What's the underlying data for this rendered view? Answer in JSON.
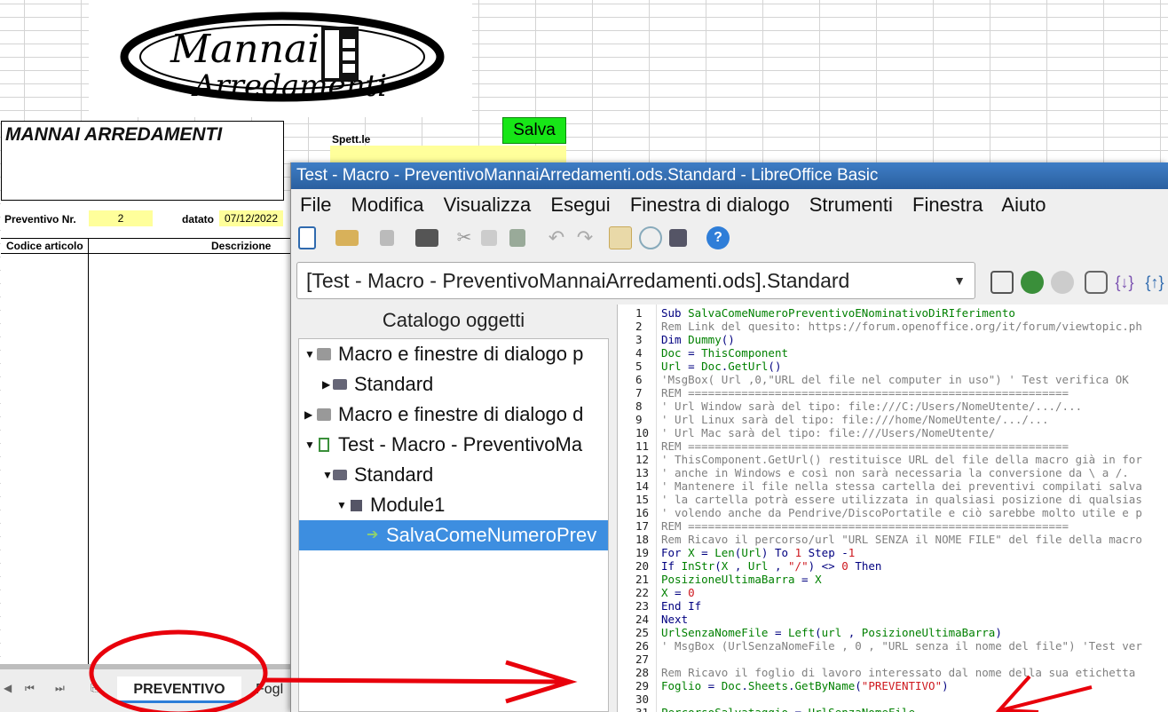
{
  "logo": {
    "line1": "Mannai",
    "line2": "Arredamenti"
  },
  "sheet": {
    "company": "MANNAI ARREDAMENTI",
    "spett_label": "Spett.le",
    "salva_button": "Salva",
    "preventivo_label": "Preventivo Nr.",
    "preventivo_value": "2",
    "datato_label": "datato",
    "datato_value": "07/12/2022",
    "col_codice": "Codice articolo",
    "col_descrizione": "Descrizione",
    "tabs": {
      "active": "PREVENTIVO",
      "next": "Fogl"
    }
  },
  "ide": {
    "title": "Test - Macro - PreventivoMannaiArredamenti.ods.Standard - LibreOffice Basic",
    "menu": [
      "File",
      "Modifica",
      "Visualizza",
      "Esegui",
      "Finestra di dialogo",
      "Strumenti",
      "Finestra",
      "Aiuto"
    ],
    "library_select": "[Test - Macro - PreventivoMannaiArredamenti.ods].Standard",
    "catalog_title": "Catalogo oggetti",
    "tree": [
      {
        "label": "Macro e finestre di dialogo p",
        "level": 0,
        "expanded": true,
        "icon": "drive-icon"
      },
      {
        "label": "Standard",
        "level": 1,
        "expanded": false,
        "icon": "library-icon"
      },
      {
        "label": "Macro e finestre di dialogo d",
        "level": 0,
        "expanded": false,
        "icon": "drive-icon"
      },
      {
        "label": "Test - Macro - PreventivoMa",
        "level": 0,
        "expanded": true,
        "icon": "document-icon"
      },
      {
        "label": "Standard",
        "level": 1,
        "expanded": true,
        "icon": "library-icon"
      },
      {
        "label": "Module1",
        "level": 2,
        "expanded": true,
        "icon": "module-icon"
      },
      {
        "label": "SalvaComeNumeroPrev",
        "level": 3,
        "selected": true,
        "icon": "macro-icon"
      }
    ],
    "code": [
      "Sub SalvaComeNumeroPreventivoENominativoDiRIferimento",
      "Rem Link del quesito: https://forum.openoffice.org/it/forum/viewtopic.ph",
      "Dim Dummy()",
      "Doc = ThisComponent",
      "Url = Doc.GetUrl()",
      "'MsgBox( Url ,0,\"URL del file nel computer in uso\") ' Test verifica OK",
      "REM =========================================================",
      "' Url Window sarà del tipo: file:///C:/Users/NomeUtente/.../...",
      "' Url Linux sarà del tipo: file:///home/NomeUtente/.../...",
      "' Url Mac sarà del tipo: file:///Users/NomeUtente/",
      "REM =========================================================",
      "' ThisComponent.GetUrl() restituisce URL del file della macro già in for",
      "' anche in Windows e così non sarà necessaria la conversione da \\ a /.",
      "' Mantenere il file nella stessa cartella dei preventivi compilati salva",
      "' la cartella potrà essere utilizzata in qualsiasi posizione di qualsias",
      "' volendo anche da Pendrive/DiscoPortatile e ciò sarebbe molto utile e p",
      "REM =========================================================",
      "Rem Ricavo il percorso/url \"URL SENZA il NOME FILE\" del file della macro",
      "For X = Len(Url) To 1 Step -1",
      "If InStr(X , Url , \"/\") <> 0 Then",
      "PosizioneUltimaBarra = X",
      "X = 0",
      "End If",
      "Next",
      "UrlSenzaNomeFile = Left(url , PosizioneUltimaBarra)",
      "' MsgBox (UrlSenzaNomeFile , 0 , \"URL senza il nome del file\") 'Test ver",
      "",
      "Rem Ricavo il foglio di lavoro interessato dal nome della sua etichetta",
      "Foglio = Doc.Sheets.GetByName(\"PREVENTIVO\")",
      "",
      "PercorsoSalvataggio = UrlSenzaNomeFile"
    ]
  },
  "colors": {
    "annotation": "#e8000b",
    "salva": "#17e617",
    "title_bar": "#2f6aae",
    "selection": "#3d8ee0",
    "highlight": "#ffff9b"
  }
}
